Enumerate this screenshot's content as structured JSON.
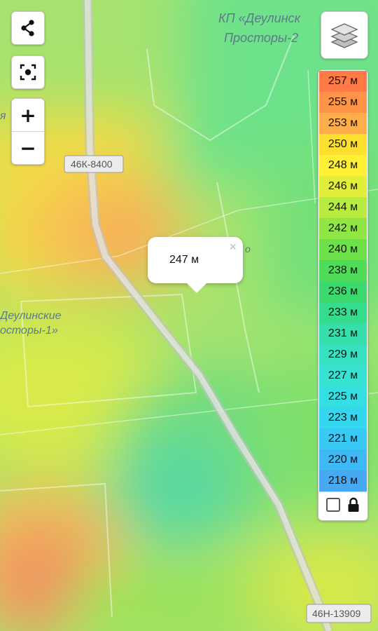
{
  "map": {
    "labels": {
      "kp_line1": "КП «Деулинск",
      "kp_line2": "Просторы-2",
      "left_line1": "Деулинские",
      "left_line2": "осторы-1»",
      "edge_letter": "я",
      "edge_letter2": "о"
    },
    "road_shields": {
      "top": "46К-8400",
      "bottom": "46Н-13909"
    }
  },
  "controls": {
    "share_icon": "share-icon",
    "locate_icon": "locate-icon",
    "zoom_in": "+",
    "zoom_out": "−",
    "layers_icon": "layers-icon"
  },
  "legend": {
    "items": [
      {
        "label": "257 м",
        "color": "#ff7a45"
      },
      {
        "label": "255 м",
        "color": "#ff9448"
      },
      {
        "label": "253 м",
        "color": "#ffae4a"
      },
      {
        "label": "250 м",
        "color": "#ffdf2f"
      },
      {
        "label": "248 м",
        "color": "#ffef35"
      },
      {
        "label": "246 м",
        "color": "#e1ef3a"
      },
      {
        "label": "244 м",
        "color": "#b9ec40"
      },
      {
        "label": "242 м",
        "color": "#8fe644"
      },
      {
        "label": "240 м",
        "color": "#6ee04a"
      },
      {
        "label": "238 м",
        "color": "#4fdc58"
      },
      {
        "label": "236 м",
        "color": "#3cd96e"
      },
      {
        "label": "233 м",
        "color": "#36dc8e"
      },
      {
        "label": "231 м",
        "color": "#35deaa"
      },
      {
        "label": "229 м",
        "color": "#36e1c2"
      },
      {
        "label": "227 м",
        "color": "#36e3d2"
      },
      {
        "label": "225 м",
        "color": "#34dfe2"
      },
      {
        "label": "223 м",
        "color": "#35d7ee"
      },
      {
        "label": "221 м",
        "color": "#38c9f4"
      },
      {
        "label": "220 м",
        "color": "#3fb9f4"
      },
      {
        "label": "218 м",
        "color": "#47a9f1"
      }
    ],
    "lock_icon": "lock-icon"
  },
  "popup": {
    "value": "247 м",
    "close": "×"
  }
}
